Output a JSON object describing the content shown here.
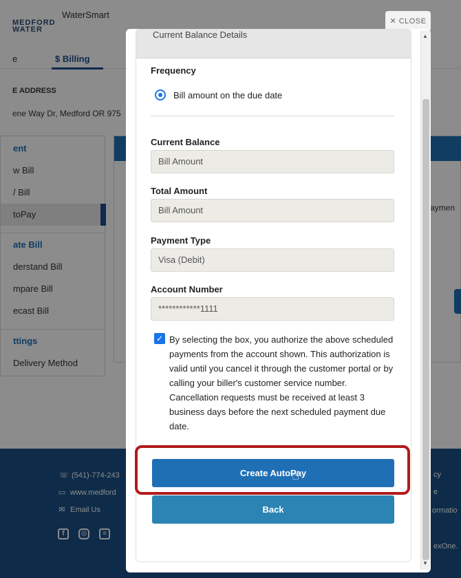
{
  "brand": {
    "logo_line1": "MEDFORD",
    "logo_line2": "WATER",
    "app_title": "WaterSmart"
  },
  "nav": {
    "tab_home_fragment": "e",
    "tab_billing": "$ Billing"
  },
  "address": {
    "heading": "E ADDRESS",
    "text": "ene Way Dr, Medford OR 975"
  },
  "side_menu": {
    "items": [
      {
        "label": "ent",
        "type": "heading"
      },
      {
        "label": "w Bill"
      },
      {
        "label": "/ Bill"
      },
      {
        "label": "toPay",
        "active": true
      },
      {
        "label": "ate Bill",
        "type": "heading"
      },
      {
        "label": "derstand Bill"
      },
      {
        "label": "mpare Bill"
      },
      {
        "label": "ecast Bill"
      },
      {
        "label": "ttings",
        "type": "heading"
      },
      {
        "label": "Delivery Method"
      }
    ]
  },
  "content": {
    "payment_fragment": "aymen"
  },
  "footer": {
    "phone": "(541)-774-243",
    "website": "www.medford",
    "email": "Email Us",
    "right_1": "cy",
    "right_2": "e",
    "right_3": "ormatio",
    "right_4": "exOne."
  },
  "modal": {
    "close_label": "CLOSE",
    "header_title": "Current Balance Details",
    "frequency_label": "Frequency",
    "frequency_option": "Bill amount on the due date",
    "current_balance_label": "Current Balance",
    "current_balance_value": "Bill Amount",
    "total_amount_label": "Total Amount",
    "total_amount_value": "Bill Amount",
    "payment_type_label": "Payment Type",
    "payment_type_value": "Visa (Debit)",
    "account_number_label": "Account Number",
    "account_number_value": "************1111",
    "consent_text": "By selecting the box, you authorize the above scheduled payments from the account shown. This authorization is valid until you cancel it through the customer portal or by calling your biller's customer service number. Cancellation requests must be received at least 3 business days before the next scheduled payment due date.",
    "create_button": "Create AutoPay",
    "back_button": "Back"
  },
  "colors": {
    "primary_blue": "#1f6fb5",
    "back_blue": "#2b84b3",
    "highlight_red": "#b11a1a",
    "footer_blue": "#1b4f86"
  }
}
